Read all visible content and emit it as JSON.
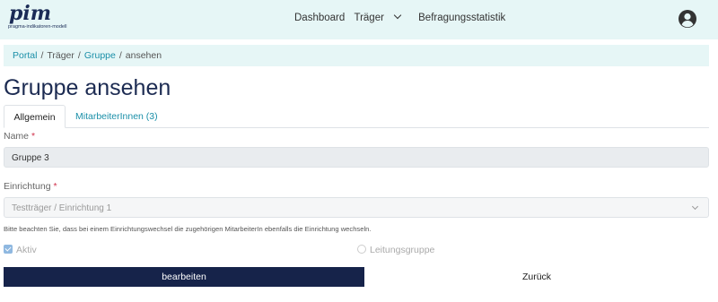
{
  "header": {
    "logo_text": "pim",
    "logo_subtitle": "pragma-indikatoren-modell",
    "nav": [
      {
        "label": "Dashboard"
      },
      {
        "label": "Träger"
      },
      {
        "label": "Befragungsstatistik"
      }
    ],
    "user_icon": "user-circle-icon"
  },
  "breadcrumb": {
    "items": [
      "Portal",
      "Träger",
      "Gruppe",
      "ansehen"
    ],
    "separator": "/"
  },
  "page_title": "Gruppe ansehen",
  "tabs": [
    {
      "label": "Allgemein",
      "active": true
    },
    {
      "label": "MitarbeiterInnen (3)",
      "active": false
    }
  ],
  "form": {
    "name_label": "Name",
    "name_value": "Gruppe 3",
    "required_marker": "*",
    "einrichtung_label": "Einrichtung",
    "einrichtung_value": "Testträger / Einrichtung 1",
    "hint": "Bitte beachten Sie, dass bei einem Einrichtungswechsel die zugehörigen MitarbeiterIn ebenfalls die Einrichtung wechseln.",
    "aktiv_label": "Aktiv",
    "aktiv_checked": true,
    "leitungsgruppe_label": "Leitungsgruppe",
    "leitungsgruppe_checked": false
  },
  "buttons": {
    "edit_label": "bearbeiten",
    "back_label": "Zurück"
  },
  "colors": {
    "header_bg": "#e6f6f6",
    "primary": "#16234a",
    "link": "#1a8fa8",
    "required": "#d0304a"
  }
}
